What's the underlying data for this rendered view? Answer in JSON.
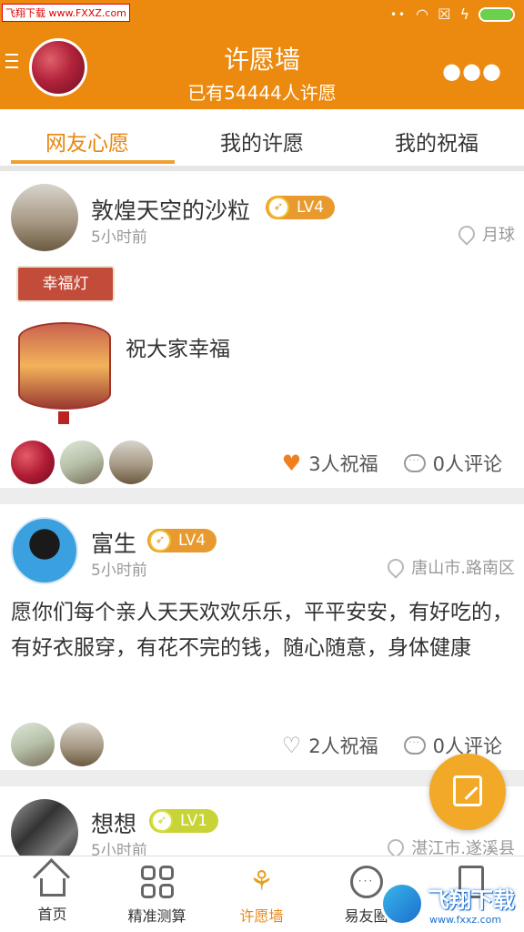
{
  "watermark_top": "飞翔下载 www.FXXZ.com",
  "statusbar": {
    "battery_level": 0.95
  },
  "header": {
    "title": "许愿墙",
    "subtitle": "已有54444人许愿"
  },
  "tabs": [
    {
      "label": "网友心愿",
      "active": true
    },
    {
      "label": "我的许愿",
      "active": false
    },
    {
      "label": "我的祝福",
      "active": false
    }
  ],
  "posts": [
    {
      "username": "敦煌天空的沙粒",
      "level": "LV4",
      "time": "5小时前",
      "location": "月球",
      "lantern_label": "幸福灯",
      "content": "祝大家幸福",
      "blessings": "3人祝福",
      "comments": "0人评论"
    },
    {
      "username": "富生",
      "level": "LV4",
      "time": "5小时前",
      "location": "唐山市.路南区",
      "content": "愿你们每个亲人天天欢欢乐乐，平平安安，有好吃的，有好衣服穿，有花不完的钱，随心随意，身体健康",
      "blessings": "2人祝福",
      "comments": "0人评论"
    },
    {
      "username": "想想",
      "level": "LV1",
      "time": "5小时前",
      "location": "湛江市.遂溪县"
    }
  ],
  "bottom_nav": [
    {
      "label": "首页",
      "icon": "home-icon"
    },
    {
      "label": "精准测算",
      "icon": "grid-icon"
    },
    {
      "label": "许愿墙",
      "icon": "tulip-icon",
      "active": true
    },
    {
      "label": "易友圈",
      "icon": "chat-icon"
    },
    {
      "label": "",
      "icon": "book-icon"
    }
  ],
  "watermark_bottom": {
    "cn": "飞翔下载",
    "url": "www.fxxz.com"
  }
}
